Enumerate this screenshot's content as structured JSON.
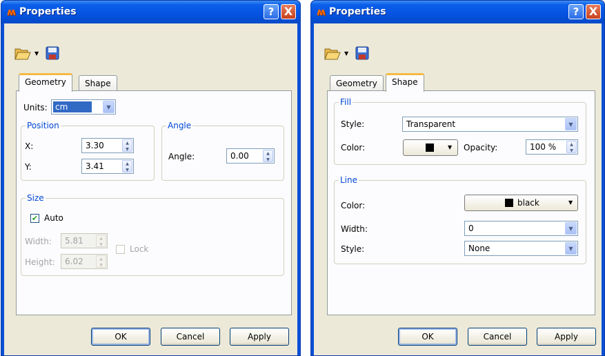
{
  "app_title": "Properties",
  "title_help": "?",
  "title_close": "X",
  "tabs": {
    "geometry": "Geometry",
    "shape": "Shape"
  },
  "geometry": {
    "units_label": "Units:",
    "units_value": "cm",
    "position": {
      "title": "Position",
      "x_label": "X:",
      "x_value": "3.30",
      "y_label": "Y:",
      "y_value": "3.41"
    },
    "angle": {
      "title": "Angle",
      "angle_label": "Angle:",
      "angle_value": "0.00"
    },
    "size": {
      "title": "Size",
      "auto_label": "Auto",
      "auto_checked": true,
      "width_label": "Width:",
      "width_value": "5.81",
      "height_label": "Height:",
      "height_value": "6.02",
      "lock_label": "Lock"
    }
  },
  "shape": {
    "fill": {
      "title": "Fill",
      "style_label": "Style:",
      "style_value": "Transparent",
      "color_label": "Color:",
      "color_value": "#000000",
      "opacity_label": "Opacity:",
      "opacity_value": "100 %"
    },
    "line": {
      "title": "Line",
      "color_label": "Color:",
      "color_name": "black",
      "width_label": "Width:",
      "width_value": "0",
      "style_label": "Style:",
      "style_value": "None"
    }
  },
  "buttons": {
    "ok": "OK",
    "cancel": "Cancel",
    "apply": "Apply"
  },
  "colors": {
    "accent": "#0046d5",
    "titlebar": "#0553e0",
    "client": "#ece9d8",
    "tab_highlight": "#f7b942"
  },
  "icons": [
    "open-folder-icon",
    "save-icon",
    "app-icon",
    "help-icon",
    "close-icon"
  ]
}
